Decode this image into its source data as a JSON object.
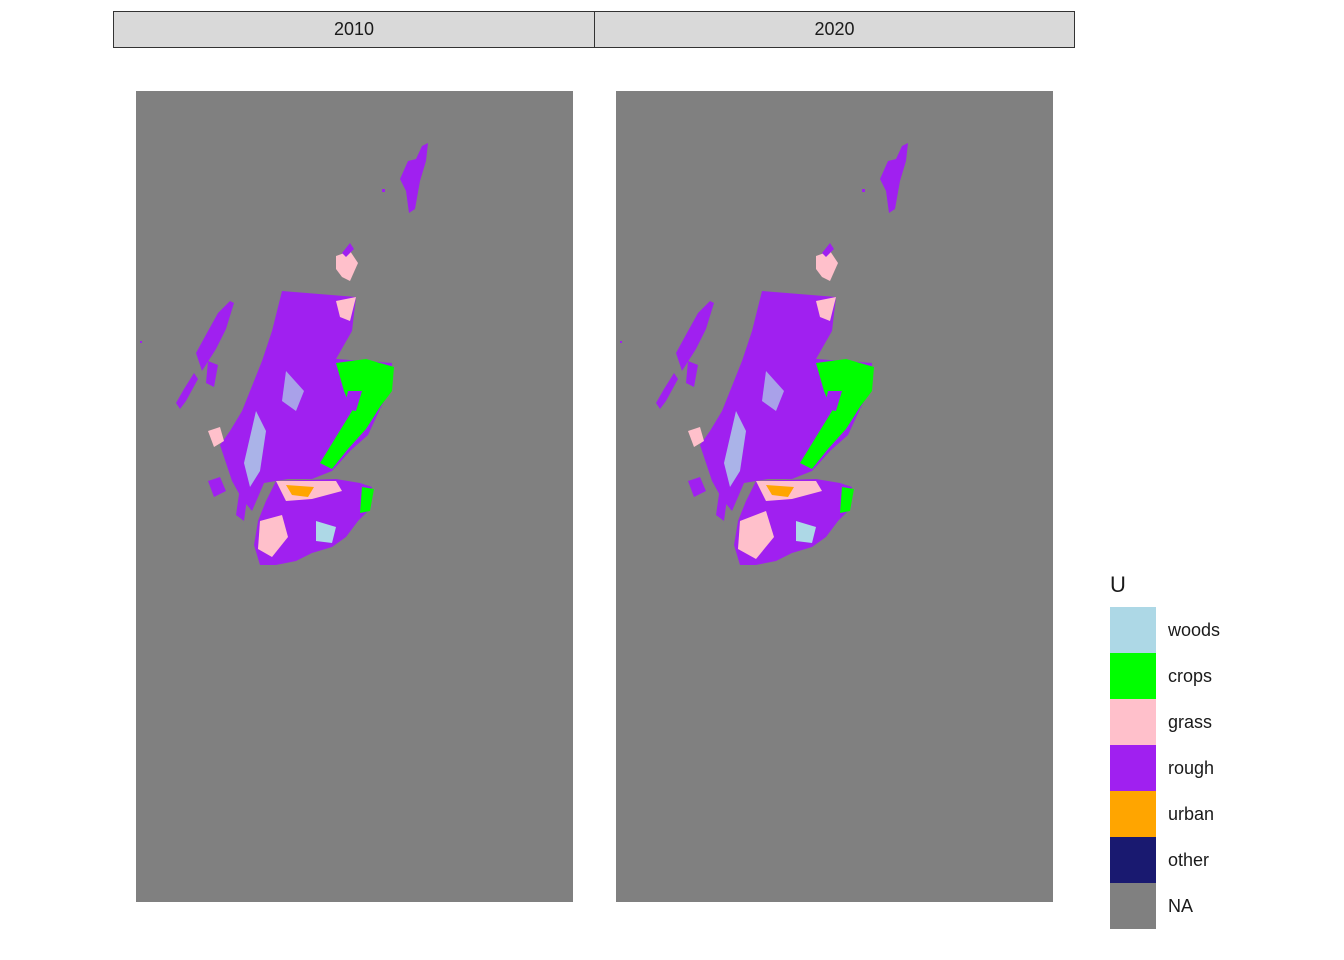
{
  "chart_data": {
    "type": "heatmap",
    "facets": [
      {
        "label": "2010"
      },
      {
        "label": "2020"
      }
    ],
    "legend": {
      "title": "U",
      "position": "right",
      "entries": [
        {
          "label": "woods",
          "color": "#add8e6"
        },
        {
          "label": "crops",
          "color": "#00ff00"
        },
        {
          "label": "grass",
          "color": "#ffc0cb"
        },
        {
          "label": "rough",
          "color": "#a020f0"
        },
        {
          "label": "urban",
          "color": "#ffa500"
        },
        {
          "label": "other",
          "color": "#191970"
        },
        {
          "label": "NA",
          "color": "#808080"
        }
      ]
    },
    "background_color": "#808080",
    "grid": false
  }
}
